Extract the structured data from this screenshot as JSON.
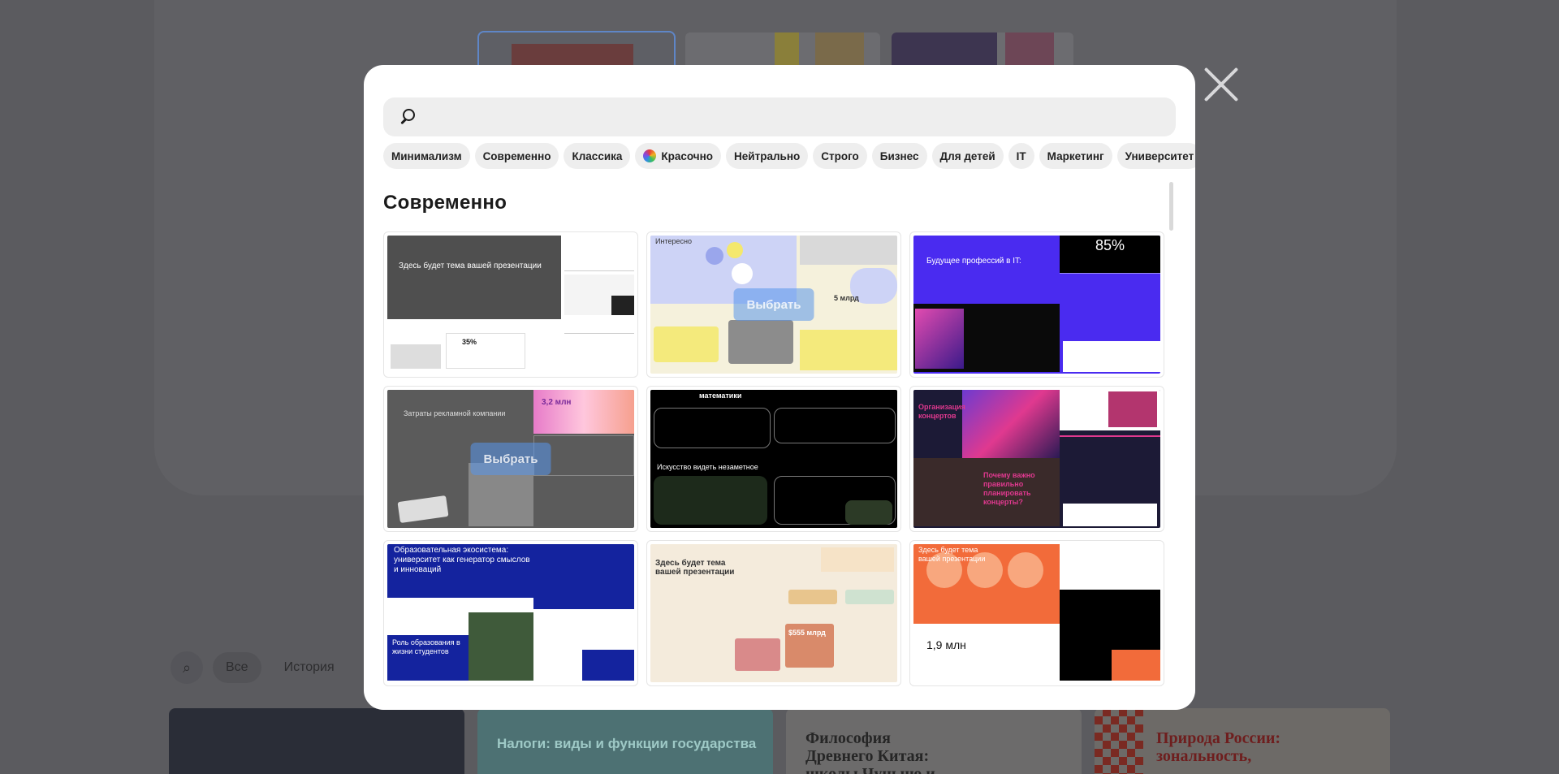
{
  "background": {
    "tabs": [
      "Все",
      "История"
    ],
    "cards": [
      {
        "title": ""
      },
      {
        "title": "Налоги: виды и функции государства"
      },
      {
        "title": "Философия Древнего Китая: школы Чуньцю и"
      },
      {
        "title": "Природа России: зональность,"
      }
    ]
  },
  "modal": {
    "search": {
      "placeholder": "",
      "value": ""
    },
    "chips": [
      {
        "label": "Минимализм"
      },
      {
        "label": "Современно"
      },
      {
        "label": "Классика"
      },
      {
        "label": "Красочно",
        "icon": "color-wheel-icon"
      },
      {
        "label": "Нейтрально"
      },
      {
        "label": "Строго"
      },
      {
        "label": "Бизнес"
      },
      {
        "label": "Для детей"
      },
      {
        "label": "IT"
      },
      {
        "label": "Маркетинг"
      },
      {
        "label": "Университет"
      }
    ],
    "more_label": "•••",
    "section_title": "Современно",
    "choose_label": "Выбрать",
    "templates": [
      {
        "title": "Здесь будет тема вашей презентации",
        "stat": "35%"
      },
      {
        "title": "Интересно",
        "stat": "5 млрд"
      },
      {
        "title": "Будущее профессий в IT:",
        "stat": "85%"
      },
      {
        "title": "Затраты рекламной компании",
        "stat": "3,2 млн"
      },
      {
        "title": "математики",
        "stat": "Искусство видеть незаметное"
      },
      {
        "title": "Организация концертов",
        "stat": "Почему важно правильно планировать концерты?"
      },
      {
        "title": "Образовательная экосистема: университет как генератор смыслов и инноваций",
        "stat": "Роль образования в жизни студентов"
      },
      {
        "title": "Здесь будет тема вашей презентации",
        "stat": "$555 млрд"
      },
      {
        "title": "Здесь будет тема вашей презентации",
        "stat": "1,9 млн"
      }
    ]
  }
}
